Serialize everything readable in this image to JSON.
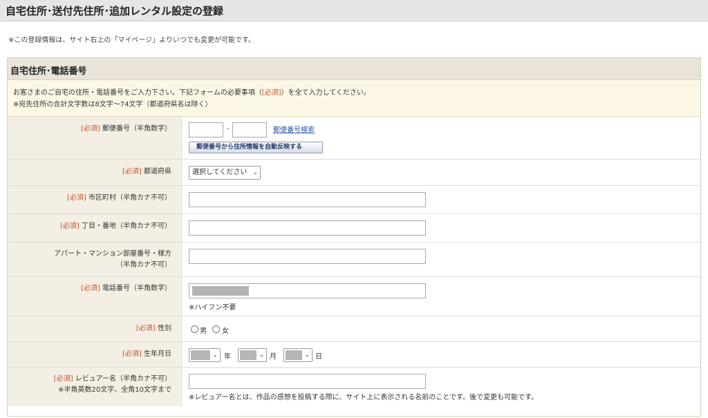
{
  "page_title": "自宅住所･送付先住所･追加レンタル設定の登録",
  "notice": "※この登録情報は、サイト右上の「マイページ」よりいつでも変更が可能です。",
  "panel": {
    "title": "自宅住所･電話番号",
    "instruction_pre": "お客さまのご自宅の住所・電話番号をご入力下さい。下記フォームの必要事項（",
    "instruction_req": "[必須]",
    "instruction_post": "）を全て入力してください。",
    "instruction_line2": "※宛先住所の合計文字数は8文字〜74文字（都道府県名は除く）"
  },
  "required_tag": "[必須]",
  "fields": {
    "postal": {
      "label": "郵便番号（半角数字）",
      "hyphen": "-",
      "search_link": "郵便番号検索",
      "autofill_button": "郵便番号から住所情報を自動反映する",
      "value1": "",
      "value2": ""
    },
    "prefecture": {
      "label": "都道府県",
      "selected": "選択してください"
    },
    "city": {
      "label": "市区町村（半角カナ不可）",
      "value": ""
    },
    "street": {
      "label": "丁目・番地（半角カナ不可）",
      "value": ""
    },
    "building": {
      "label_line1": "アパート・マンション部屋番号・様方",
      "label_line2": "（半角カナ不可）",
      "value": ""
    },
    "phone": {
      "label": "電話番号（半角数字）",
      "note": "※ハイフン不要"
    },
    "gender": {
      "label": "性別",
      "option_male": "男",
      "option_female": "女"
    },
    "birthdate": {
      "label": "生年月日",
      "year_unit": "年",
      "month_unit": "月",
      "day_unit": "日"
    },
    "reviewer": {
      "label": "レビュアー名（半角カナ不可）",
      "label_line2": "※半角英数20文字、全角10文字まで",
      "note": "※レビュアー名とは、作品の感想を投稿する際に、サイト上に表示される名前のことです。後で変更も可能です。",
      "value": ""
    }
  },
  "colors": {
    "required": "#c9502b",
    "header_bg": "#e6e6e6",
    "panel_head_bg": "#e9e4d7",
    "label_bg": "#f3efe4",
    "instruction_bg": "#fdf8e6",
    "link": "#2a5aa8"
  },
  "icons": {
    "select": "chevron-down-icon",
    "radio": "radio-empty-icon"
  }
}
